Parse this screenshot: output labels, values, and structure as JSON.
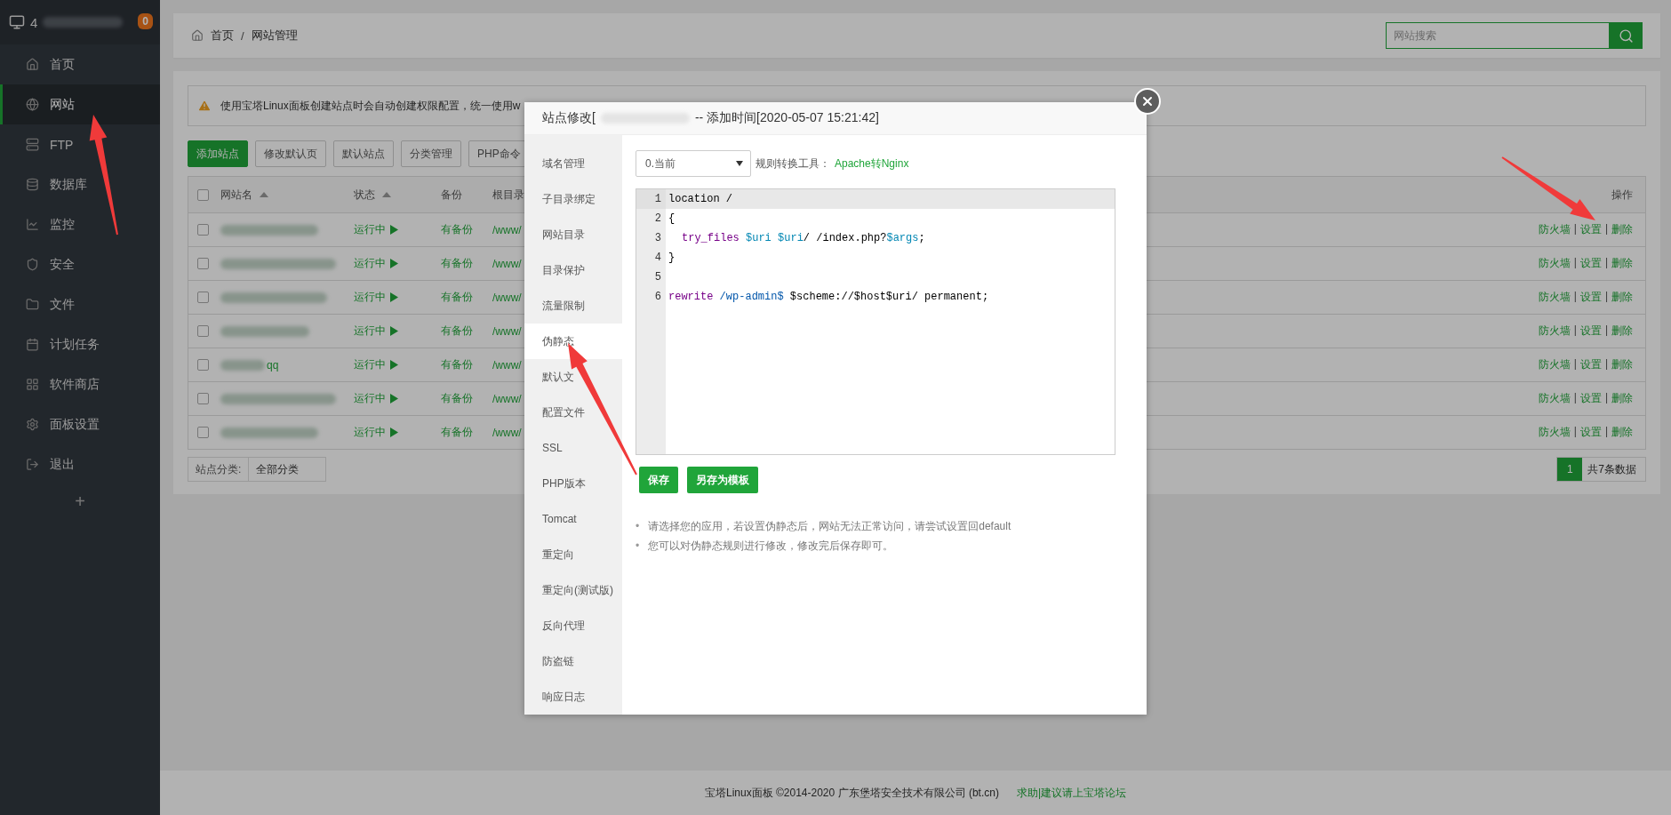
{
  "sidebar": {
    "brand": "4",
    "badge": "0",
    "items": [
      {
        "label": "首页",
        "selected": false
      },
      {
        "label": "网站",
        "selected": true
      },
      {
        "label": "FTP",
        "selected": false
      },
      {
        "label": "数据库",
        "selected": false
      },
      {
        "label": "监控",
        "selected": false
      },
      {
        "label": "安全",
        "selected": false
      },
      {
        "label": "文件",
        "selected": false
      },
      {
        "label": "计划任务",
        "selected": false
      },
      {
        "label": "软件商店",
        "selected": false
      },
      {
        "label": "面板设置",
        "selected": false
      },
      {
        "label": "退出",
        "selected": false
      }
    ],
    "add_label": "+"
  },
  "breadcrumb": {
    "items": [
      "首页",
      "网站管理"
    ],
    "separator": "/"
  },
  "search": {
    "placeholder": "网站搜索"
  },
  "alert": "使用宝塔Linux面板创建站点时会自动创建权限配置，统一使用w",
  "toolbar": [
    {
      "label": "添加站点",
      "primary": true
    },
    {
      "label": "修改默认页",
      "primary": false
    },
    {
      "label": "默认站点",
      "primary": false
    },
    {
      "label": "分类管理",
      "primary": false
    },
    {
      "label": "PHP命令",
      "primary": false
    }
  ],
  "table": {
    "select_all_checked": false,
    "columns": [
      {
        "label": "网站名",
        "sortable": true
      },
      {
        "label": "状态",
        "sortable": true
      },
      {
        "label": "备份"
      },
      {
        "label": "根目录"
      }
    ],
    "actions_label": "操作",
    "separator": "|",
    "rows": [
      {
        "checked": false,
        "status": "运行中",
        "backup": "有备份",
        "root": "/www/",
        "actions": [
          "防火墙",
          "设置",
          "删除"
        ]
      },
      {
        "checked": false,
        "status": "运行中",
        "backup": "有备份",
        "root": "/www/",
        "actions": [
          "防火墙",
          "设置",
          "删除"
        ]
      },
      {
        "checked": false,
        "status": "运行中",
        "backup": "有备份",
        "root": "/www/",
        "actions": [
          "防火墙",
          "设置",
          "删除"
        ]
      },
      {
        "checked": false,
        "status": "运行中",
        "backup": "有备份",
        "root": "/www/",
        "actions": [
          "防火墙",
          "设置",
          "删除"
        ]
      },
      {
        "checked": false,
        "name": "qq",
        "status": "运行中",
        "backup": "有备份",
        "root": "/www/",
        "actions": [
          "防火墙",
          "设置",
          "删除"
        ]
      },
      {
        "checked": false,
        "status": "运行中",
        "backup": "有备份",
        "root": "/www/",
        "actions": [
          "防火墙",
          "设置",
          "删除"
        ]
      },
      {
        "checked": false,
        "status": "运行中",
        "backup": "有备份",
        "root": "/www/",
        "actions": [
          "防火墙",
          "设置",
          "删除"
        ]
      }
    ]
  },
  "category": {
    "label": "站点分类:",
    "value": "全部分类"
  },
  "pagination": {
    "pages": [
      {
        "label": "1",
        "selected": true
      }
    ],
    "total": "共7条数据"
  },
  "modal": {
    "title_prefix": "站点修改[",
    "title_suffix": "-- 添加时间[2020-05-07 15:21:42]",
    "menu": [
      {
        "label": "域名管理",
        "selected": false
      },
      {
        "label": "子目录绑定",
        "selected": false
      },
      {
        "label": "网站目录",
        "selected": false
      },
      {
        "label": "目录保护",
        "selected": false
      },
      {
        "label": "流量限制",
        "selected": false
      },
      {
        "label": "伪静态",
        "selected": true
      },
      {
        "label": "默认文",
        "selected": false
      },
      {
        "label": "配置文件",
        "selected": false
      },
      {
        "label": "SSL",
        "selected": false
      },
      {
        "label": "PHP版本",
        "selected": false
      },
      {
        "label": "Tomcat",
        "selected": false
      },
      {
        "label": "重定向",
        "selected": false
      },
      {
        "label": "重定向(测试版)",
        "selected": false
      },
      {
        "label": "反向代理",
        "selected": false
      },
      {
        "label": "防盗链",
        "selected": false
      },
      {
        "label": "响应日志",
        "selected": false
      }
    ],
    "template_select": "0.当前",
    "converter_label": "规则转换工具：",
    "converter_link": "Apache转Nginx",
    "code": [
      {
        "number": "1",
        "active": true,
        "tokens": [
          {
            "text": "location /",
            "kind": "plain"
          }
        ]
      },
      {
        "number": "2",
        "active": false,
        "tokens": [
          {
            "text": "{",
            "kind": "plain"
          }
        ]
      },
      {
        "number": "3",
        "active": false,
        "indent": true,
        "tokens": [
          {
            "text": "try_files",
            "kind": "keyword"
          },
          {
            "text": " $uri",
            "kind": "variable"
          },
          {
            "text": " $uri",
            "kind": "variable"
          },
          {
            "text": "/ /index.php?",
            "kind": "plain"
          },
          {
            "text": "$args",
            "kind": "variable"
          },
          {
            "text": ";",
            "kind": "plain"
          }
        ]
      },
      {
        "number": "4",
        "active": false,
        "tokens": [
          {
            "text": "}",
            "kind": "plain"
          }
        ]
      },
      {
        "number": "5",
        "active": false
      },
      {
        "number": "6",
        "active": false,
        "tokens": [
          {
            "text": "rewrite",
            "kind": "keyword"
          },
          {
            "text": " /wp-admin$",
            "kind": "string"
          },
          {
            "text": " $scheme://$host$uri/ permanent;",
            "kind": "plain"
          }
        ]
      }
    ],
    "buttons": [
      "保存",
      "另存为模板"
    ],
    "note_marker": "•",
    "notes": [
      "请选择您的应用，若设置伪静态后，网站无法正常访问，请尝试设置回default",
      "您可以对伪静态规则进行修改，修改完后保存即可。"
    ]
  },
  "footer": {
    "text": "宝塔Linux面板 ©2014-2020 广东堡塔安全技术有限公司 (bt.cn)",
    "link": "求助|建议请上宝塔论坛"
  }
}
